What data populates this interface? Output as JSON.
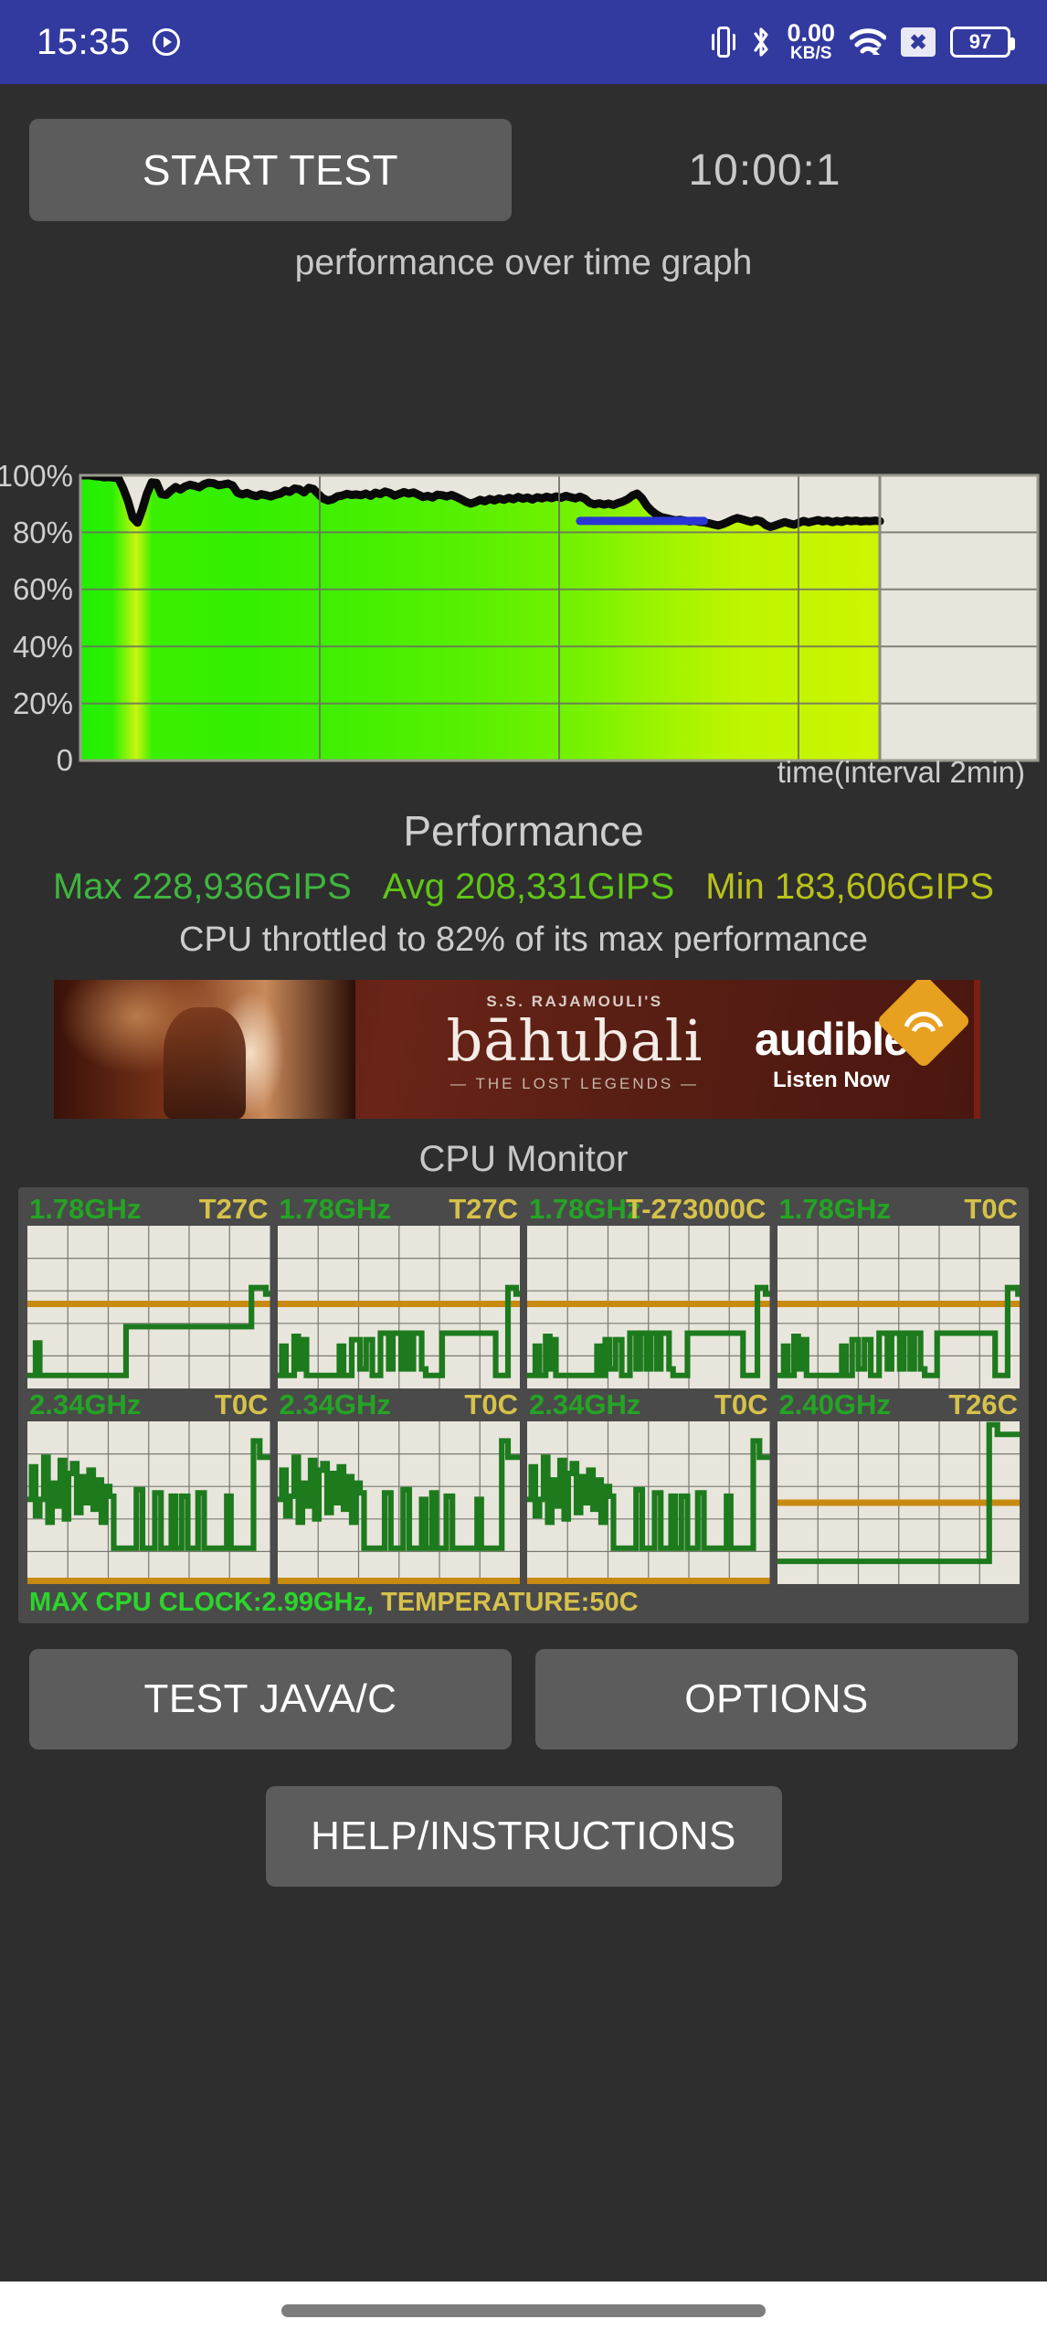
{
  "statusbar": {
    "clock": "15:35",
    "play_icon": "play-circle-icon",
    "vibrate_icon": "vibrate-icon",
    "bluetooth_icon": "bluetooth-icon",
    "net_speed_value": "0.00",
    "net_speed_unit": "KB/S",
    "wifi_icon": "wifi-icon",
    "nosim_icon": "sim-x-icon",
    "battery_level": "97",
    "bg_color": "#323aa0"
  },
  "toolbar": {
    "start_label": "START TEST",
    "timer": "10:00:1"
  },
  "graph": {
    "title": "performance over time graph",
    "xaxis_label": "time(interval 2min)"
  },
  "performance": {
    "heading": "Performance",
    "max_label": "Max 228,936GIPS",
    "avg_label": "Avg 208,331GIPS",
    "min_label": "Min 183,606GIPS",
    "throttle_text": "CPU throttled to 82% of its max performance",
    "max_color": "#3fb53f",
    "avg_color": "#5fc617",
    "min_color": "#b9c219"
  },
  "ad": {
    "presenter": "S.S. RAJAMOULI'S",
    "title": "bāhubali",
    "tagline": "— THE LOST LEGENDS —",
    "brand": "audible",
    "cta": "Listen Now",
    "logo_icon": "audible-logo-icon"
  },
  "cpu_monitor": {
    "title": "CPU Monitor",
    "cores": [
      {
        "freq": "1.78GHz",
        "temp": "T27C",
        "overflow": false
      },
      {
        "freq": "1.78GHz",
        "temp": "T27C",
        "overflow": false
      },
      {
        "freq": "1.78GHz",
        "temp": "T-273000C",
        "overflow": true
      },
      {
        "freq": "1.78GHz",
        "temp": "T0C",
        "overflow": false
      },
      {
        "freq": "2.34GHz",
        "temp": "T0C",
        "overflow": false
      },
      {
        "freq": "2.34GHz",
        "temp": "T0C",
        "overflow": false
      },
      {
        "freq": "2.34GHz",
        "temp": "T0C",
        "overflow": false
      },
      {
        "freq": "2.40GHz",
        "temp": "T26C",
        "overflow": false
      }
    ],
    "footer_clock": "MAX CPU CLOCK:2.99GHz,",
    "footer_temp": "TEMPERATURE:50C",
    "clock_color": "#2bd52b",
    "temp_color": "#d6c14a"
  },
  "buttons": {
    "test_java_c": "TEST JAVA/C",
    "options": "OPTIONS",
    "help": "HELP/INSTRUCTIONS"
  },
  "chart_data": {
    "type": "line",
    "title": "performance over time graph",
    "xlabel": "time(interval 2min)",
    "ylabel": "",
    "ylim": [
      0,
      100
    ],
    "ytick_labels": [
      "100%",
      "80%",
      "60%",
      "40%",
      "20%",
      "0"
    ],
    "ytick_values": [
      100,
      80,
      60,
      40,
      20,
      0
    ],
    "grid": true,
    "legend": "none",
    "x_gridlines": [
      0,
      0.25,
      0.5,
      0.75,
      1.0
    ],
    "filled_fraction": 0.835,
    "series": [
      {
        "name": "performance %",
        "color": "#000000",
        "values": [
          100,
          100,
          100,
          99.7,
          99.6,
          99.3,
          99.4,
          99.2,
          98.9,
          95.4,
          91.0,
          85.2,
          83.4,
          88.0,
          93.6,
          97.5,
          97.3,
          93.4,
          93.1,
          94.6,
          95.9,
          95.0,
          96.1,
          96.7,
          96.3,
          95.8,
          96.9,
          97.4,
          97.2,
          96.5,
          96.8,
          97.1,
          96.4,
          93.9,
          93.3,
          93.8,
          93.1,
          92.7,
          93.4,
          93.0,
          92.6,
          93.2,
          93.6,
          94.6,
          94.2,
          95.4,
          95.1,
          94.0,
          95.6,
          95.2,
          93.4,
          91.9,
          91.2,
          91.6,
          92.6,
          92.9,
          93.5,
          93.1,
          93.3,
          93.0,
          93.6,
          92.8,
          93.9,
          93.4,
          94.3,
          93.8,
          92.9,
          93.5,
          94.1,
          93.6,
          94.0,
          93.2,
          92.4,
          92.8,
          92.2,
          93.2,
          93.0,
          92.6,
          93.1,
          92.4,
          91.6,
          90.7,
          90.1,
          90.6,
          91.4,
          90.9,
          91.7,
          91.2,
          91.9,
          91.4,
          92.1,
          91.6,
          92.4,
          91.8,
          92.2,
          91.5,
          92.3,
          91.9,
          92.5,
          92.0,
          92.6,
          92.1,
          92.8,
          92.3,
          91.9,
          92.5,
          91.8,
          90.4,
          89.8,
          90.2,
          89.7,
          90.1,
          89.6,
          90.3,
          90.8,
          91.6,
          92.9,
          93.6,
          92.0,
          89.4,
          87.6,
          86.3,
          85.4,
          85.0,
          84.6,
          84.2,
          84.4,
          84.1,
          83.8,
          84.0,
          83.7,
          83.5,
          83.2,
          82.8,
          82.4,
          82.9,
          83.6,
          84.4,
          85.0,
          84.6,
          84.1,
          83.7,
          84.3,
          83.9,
          82.6,
          81.9,
          82.4,
          83.0,
          83.6,
          83.1,
          82.7,
          83.4,
          84.0,
          83.5,
          83.9,
          84.3,
          83.8,
          84.1,
          83.6,
          84.0,
          83.7,
          84.2,
          83.9,
          84.1,
          83.8,
          84.0,
          83.9,
          84.1,
          83.9
        ]
      },
      {
        "name": "average reference",
        "color": "#2a35d6",
        "values_note": "flat blue segment near 83-84% from ~0.62 to ~0.76 of x-range"
      }
    ]
  }
}
